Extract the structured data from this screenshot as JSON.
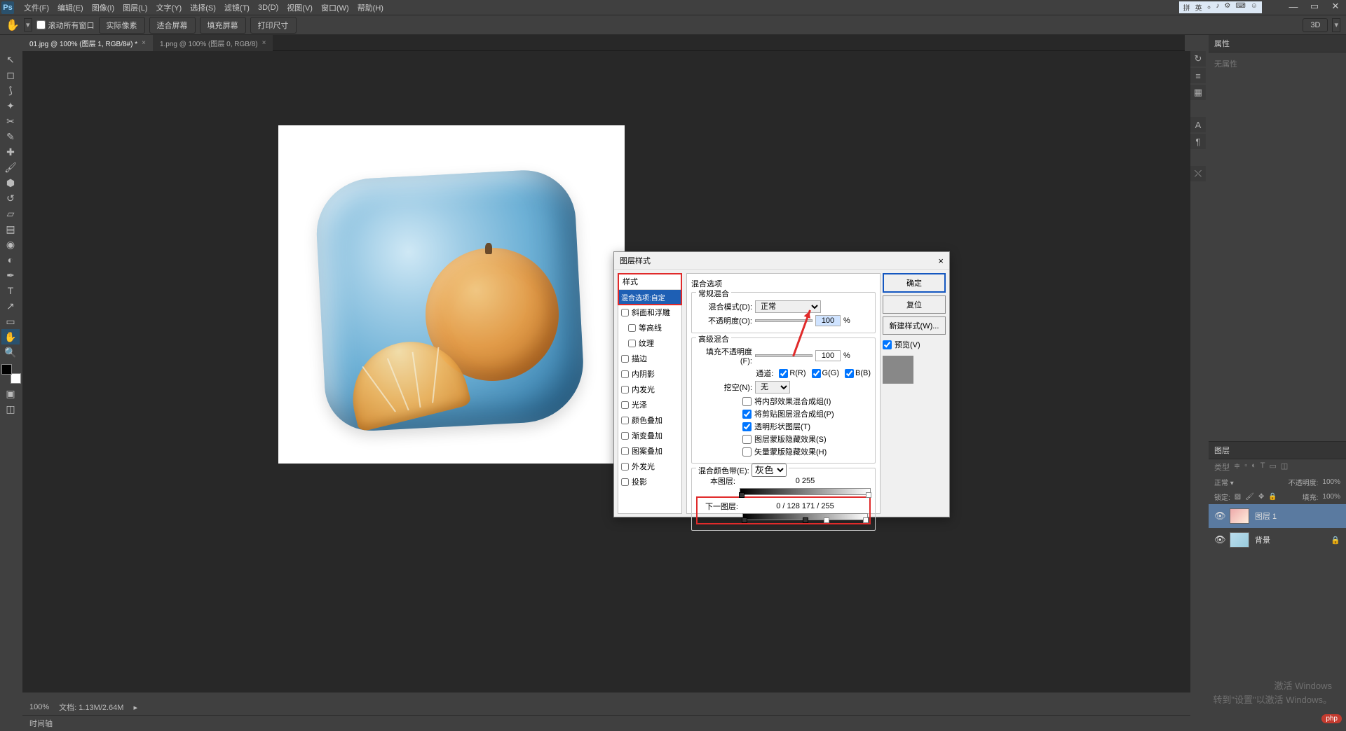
{
  "menubar": {
    "items": [
      "文件(F)",
      "编辑(E)",
      "图像(I)",
      "图层(L)",
      "文字(Y)",
      "选择(S)",
      "滤镜(T)",
      "3D(D)",
      "视图(V)",
      "窗口(W)",
      "帮助(H)"
    ]
  },
  "ime": {
    "items": [
      "拼",
      "英",
      "⸰",
      "♪",
      "⚙",
      "⌨",
      "☺"
    ]
  },
  "optbar": {
    "scroll": "滚动所有窗口",
    "btns": [
      "实际像素",
      "适合屏幕",
      "填充屏幕",
      "打印尺寸"
    ],
    "r3d": "3D"
  },
  "tabs": {
    "active": "01.jpg @ 100% (图层 1, RGB/8#) *",
    "inactive": "1.png @ 100% (图层 0, RGB/8)"
  },
  "panels": {
    "props": "属性",
    "props_body": "无属性",
    "layers": "图层",
    "kind": "类型",
    "opacity_l": "不透明度:",
    "opacity_v": "100%",
    "lock": "锁定:",
    "fill_l": "填充:",
    "fill_v": "100%"
  },
  "layers": {
    "0": "图层 1",
    "1": "背景"
  },
  "dialog": {
    "title": "图层样式",
    "style_h": "样式",
    "blend_sel": "混合选项:自定",
    "rows": [
      "斜面和浮雕",
      "等高线",
      "纹理",
      "描边",
      "内阴影",
      "内发光",
      "光泽",
      "颜色叠加",
      "渐变叠加",
      "图案叠加",
      "外发光",
      "投影"
    ],
    "grp": "混合选项",
    "g1": "常规混合",
    "mode_l": "混合模式(D):",
    "mode_v": "正常",
    "op_l": "不透明度(O):",
    "op_v": "100",
    "pct": "%",
    "g2": "高级混合",
    "fop_l": "填充不透明度(F):",
    "fop_v": "100",
    "chan": "通道:",
    "r": "R(R)",
    "g": "G(G)",
    "b": "B(B)",
    "knock": "挖空(N):",
    "knock_v": "无",
    "c1": "将内部效果混合成组(I)",
    "c2": "将剪贴图层混合成组(P)",
    "c3": "透明形状图层(T)",
    "c4": "图层蒙版隐藏效果(S)",
    "c5": "矢量蒙版隐藏效果(H)",
    "g3": "混合颜色带(E):",
    "gray": "灰色",
    "this_l": "本图层:",
    "this_v": "0            255",
    "under_l": "下一图层:",
    "under_v": "0  /  128            171  /  255",
    "ok": "确定",
    "cancel": "复位",
    "new": "新建样式(W)...",
    "preview": "预览(V)"
  },
  "status": {
    "zoom": "100%",
    "info": "文档: 1.13M/2.64M",
    "timeline": "时间轴"
  },
  "wm": {
    "l1": "激活 Windows",
    "l2": "转到\"设置\"以激活 Windows。"
  },
  "php": "php"
}
